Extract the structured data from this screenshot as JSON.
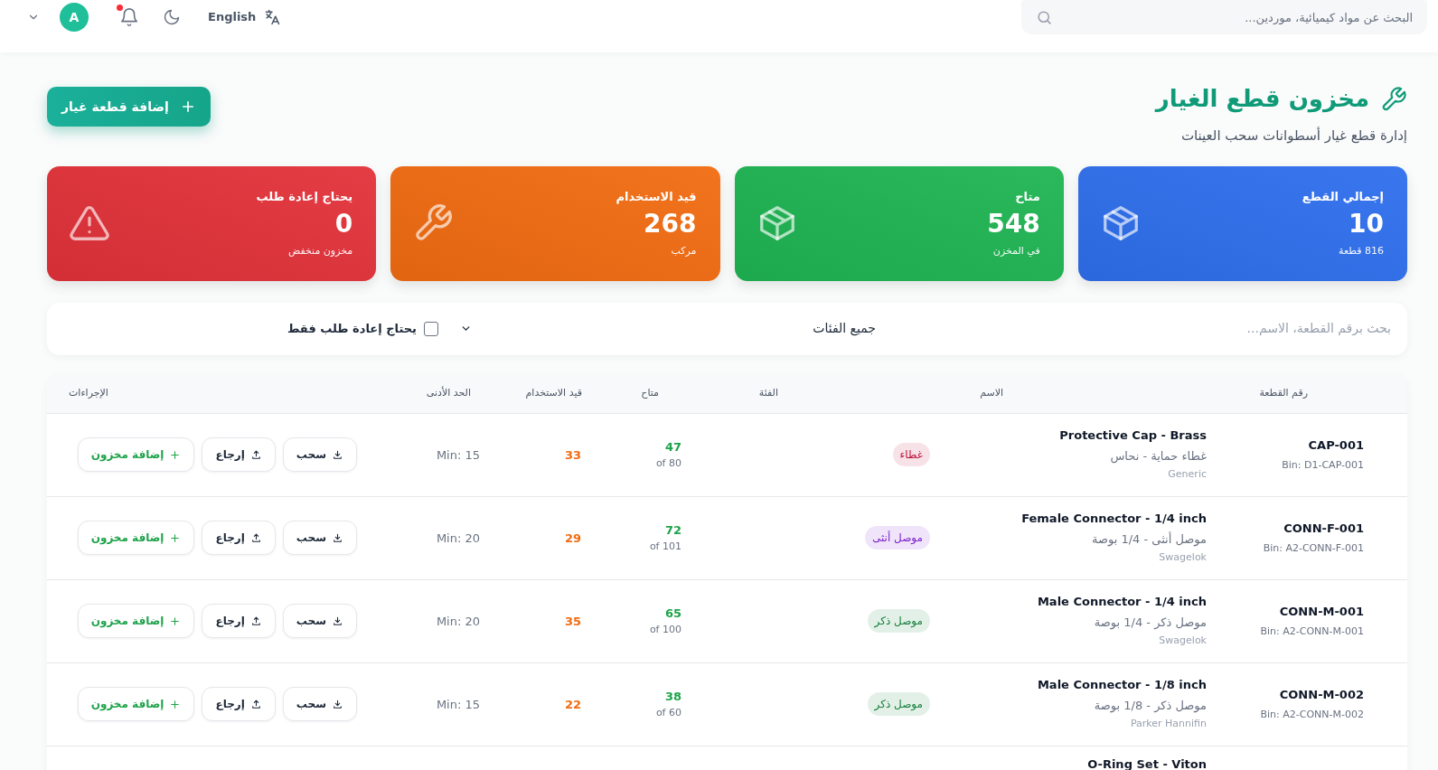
{
  "topbar": {
    "search": {
      "placeholder": "البحث عن مواد كيميائية، موردين..."
    },
    "language": "English",
    "avatar": "A",
    "notifications": {
      "unread": true
    }
  },
  "header": {
    "title": "مخزون قطع الغيار",
    "subtitle": "إدارة قطع غيار أسطوانات سحب العينات",
    "add_button": "إضافة قطعة غيار"
  },
  "stats": [
    {
      "label": "إجمالي القطع",
      "value": "10",
      "caption": "816 قطعة",
      "color": "#2f6fed",
      "kind": "box"
    },
    {
      "label": "متاح",
      "value": "548",
      "caption": "في المخزن",
      "color": "#1fb553",
      "kind": "box"
    },
    {
      "label": "قيد الاستخدام",
      "value": "268",
      "caption": "مركب",
      "color": "#f26c12",
      "kind": "wrench"
    },
    {
      "label": "يحتاج إعادة طلب",
      "value": "0",
      "caption": "مخزون منخفض",
      "color": "#e3323a",
      "kind": "warning"
    }
  ],
  "filters": {
    "search": {
      "placeholder": "بحث برقم القطعة، الاسم..."
    },
    "category": "جميع الفئات",
    "reorder_only": {
      "label": "يحتاج إعادة طلب فقط",
      "checked": false
    }
  },
  "table": {
    "columns": [
      "رقم القطعة",
      "الاسم",
      "الفئة",
      "متاح",
      "قيد الاستخدام",
      "الحد الأدنى",
      "الإجراءات"
    ],
    "rows": [
      {
        "part_no": "CAP-001",
        "bin": "Bin: D1-CAP-001",
        "name": "Protective Cap - Brass",
        "name_ar": "غطاء حماية - نحاس",
        "brand": "Generic",
        "category": {
          "label": "غطاء",
          "color": "#be123c"
        },
        "available": "47",
        "available_of": "of 80",
        "in_use": "33",
        "min": "Min: 15",
        "actions": [
          {
            "kind": "withdraw",
            "label": "سحب"
          },
          {
            "kind": "return",
            "label": "إرجاع"
          },
          {
            "kind": "add",
            "label": "إضافة مخزون"
          }
        ]
      },
      {
        "part_no": "CONN-F-001",
        "bin": "Bin: A2-CONN-F-001",
        "name": "Female Connector - 1/4 inch",
        "name_ar": "موصل أنثى - 1/4 بوصة",
        "brand": "Swagelok",
        "category": {
          "label": "موصل أنثى",
          "color": "#7e22ce"
        },
        "available": "72",
        "available_of": "of 101",
        "in_use": "29",
        "min": "Min: 20",
        "actions": [
          {
            "kind": "withdraw",
            "label": "سحب"
          },
          {
            "kind": "return",
            "label": "إرجاع"
          },
          {
            "kind": "add",
            "label": "إضافة مخزون"
          }
        ]
      },
      {
        "part_no": "CONN-M-001",
        "bin": "Bin: A2-CONN-M-001",
        "name": "Male Connector - 1/4 inch",
        "name_ar": "موصل ذكر - 1/4 بوصة",
        "brand": "Swagelok",
        "category": {
          "label": "موصل ذكر",
          "color": "#15803d"
        },
        "available": "65",
        "available_of": "of 100",
        "in_use": "35",
        "min": "Min: 20",
        "actions": [
          {
            "kind": "withdraw",
            "label": "سحب"
          },
          {
            "kind": "return",
            "label": "إرجاع"
          },
          {
            "kind": "add",
            "label": "إضافة مخزون"
          }
        ]
      },
      {
        "part_no": "CONN-M-002",
        "bin": "Bin: A2-CONN-M-002",
        "name": "Male Connector - 1/8 inch",
        "name_ar": "موصل ذكر - 1/8 بوصة",
        "brand": "Parker Hannifin",
        "category": {
          "label": "موصل ذكر",
          "color": "#15803d"
        },
        "available": "38",
        "available_of": "of 60",
        "in_use": "22",
        "min": "Min: 15",
        "actions": [
          {
            "kind": "withdraw",
            "label": "سحب"
          },
          {
            "kind": "return",
            "label": "إرجاع"
          },
          {
            "kind": "add",
            "label": "إضافة مخزون"
          }
        ]
      },
      {
        "name": "O-Ring Set - Viton"
      }
    ]
  }
}
